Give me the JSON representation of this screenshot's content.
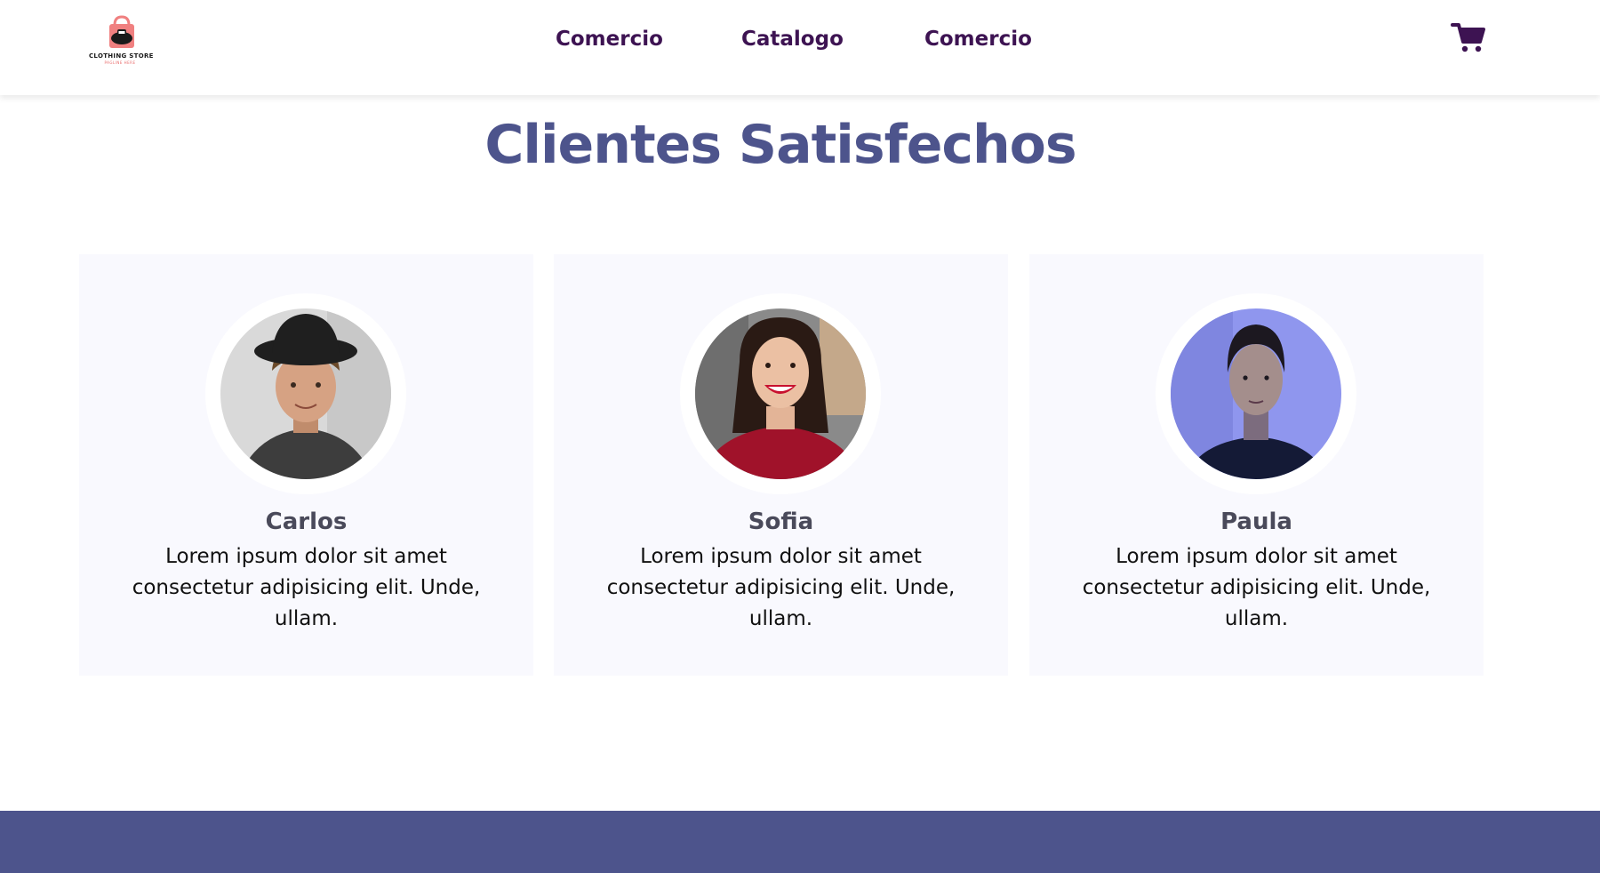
{
  "header": {
    "logo": {
      "title": "CLOTHING STORE",
      "subtitle": "PAGLINE HERE",
      "icon": "shopping-bag-logo-icon"
    },
    "nav": [
      {
        "label": "Comercio"
      },
      {
        "label": "Catalogo"
      },
      {
        "label": "Comercio"
      }
    ],
    "cart_icon": "shopping-cart-icon"
  },
  "main": {
    "title": "Clientes Satisfechos",
    "testimonials": [
      {
        "name": "Carlos",
        "text": "Lorem ipsum dolor sit amet consectetur adipisicing elit. Unde, ullam."
      },
      {
        "name": "Sofia",
        "text": "Lorem ipsum dolor sit amet consectetur adipisicing elit. Unde, ullam."
      },
      {
        "name": "Paula",
        "text": "Lorem ipsum dolor sit amet consectetur adipisicing elit. Unde, ullam."
      }
    ]
  },
  "colors": {
    "brand": "#4d548c",
    "nav_text": "#3d1352",
    "card_bg": "#f9f9fe",
    "logo_accent": "#f08080"
  }
}
